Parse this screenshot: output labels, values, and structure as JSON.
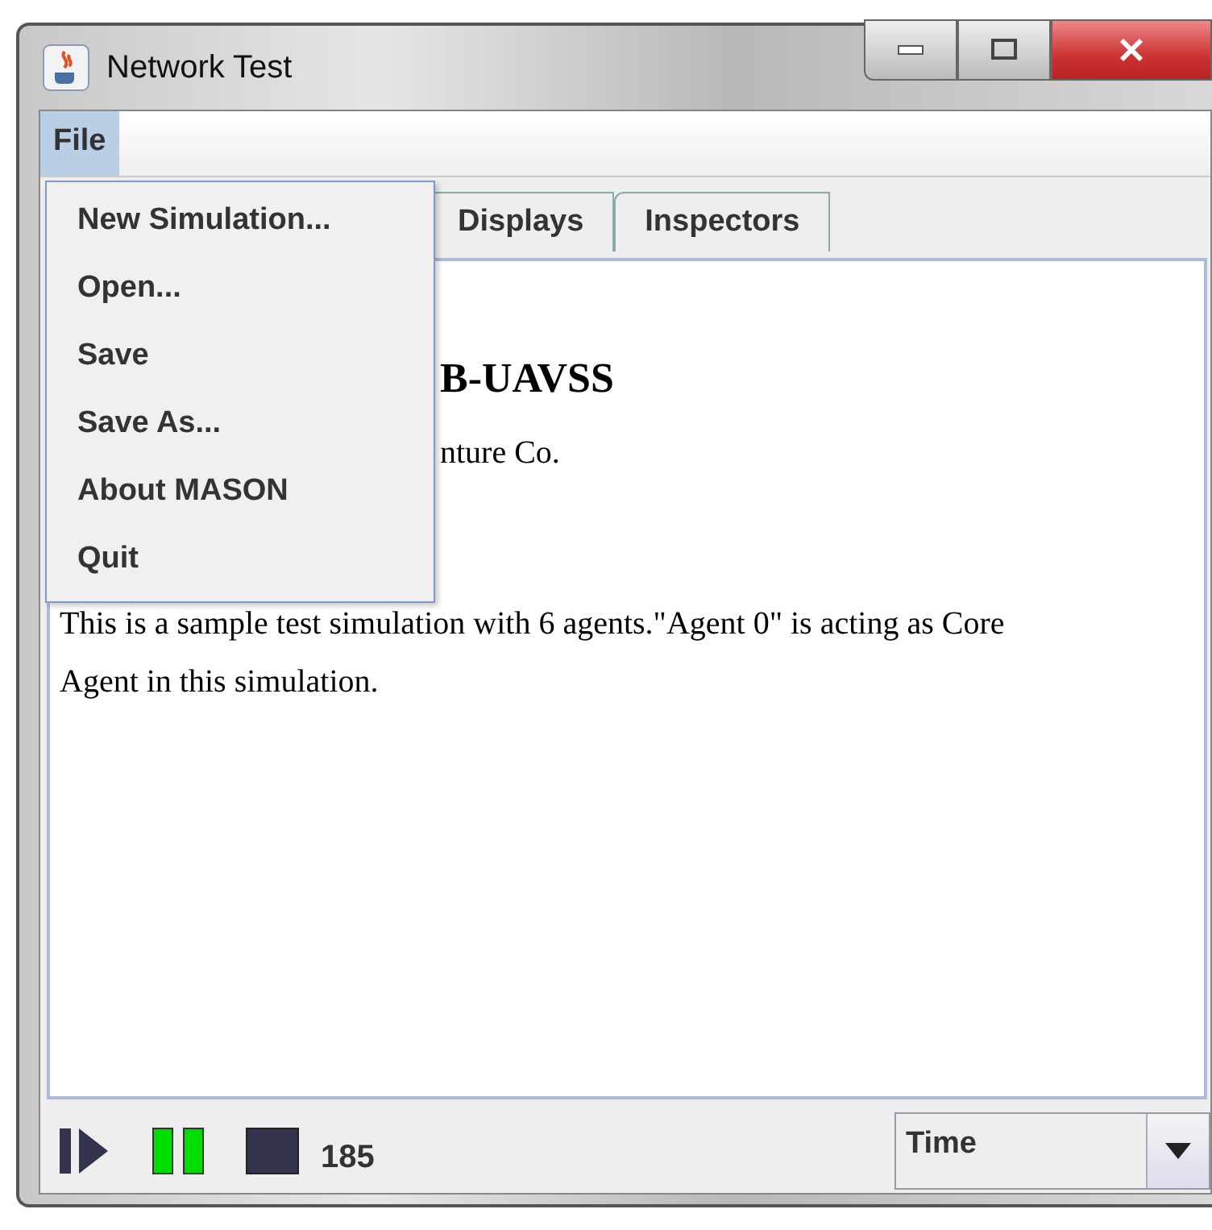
{
  "window": {
    "title": "Network Test"
  },
  "menubar": [
    {
      "label": "File",
      "selected": true
    }
  ],
  "menu": {
    "items": [
      "New Simulation...",
      "Open...",
      "Save",
      "Save As...",
      "About MASON",
      "Quit"
    ]
  },
  "tabs": [
    {
      "label": "Displays",
      "selected": false
    },
    {
      "label": "Inspectors",
      "selected": false
    }
  ],
  "content": {
    "heading": "B-UAVSS",
    "subtitle": "nture Co.",
    "paragraph": "This is a sample test simulation with 6 agents.\"Agent 0\" is acting as Core Agent in this simulation."
  },
  "controls": [
    {
      "kind": "play",
      "active": false
    },
    {
      "kind": "pause",
      "active": true
    },
    {
      "kind": "stop",
      "active": false
    }
  ],
  "step_count": "185",
  "time_select": {
    "value": "Time"
  }
}
